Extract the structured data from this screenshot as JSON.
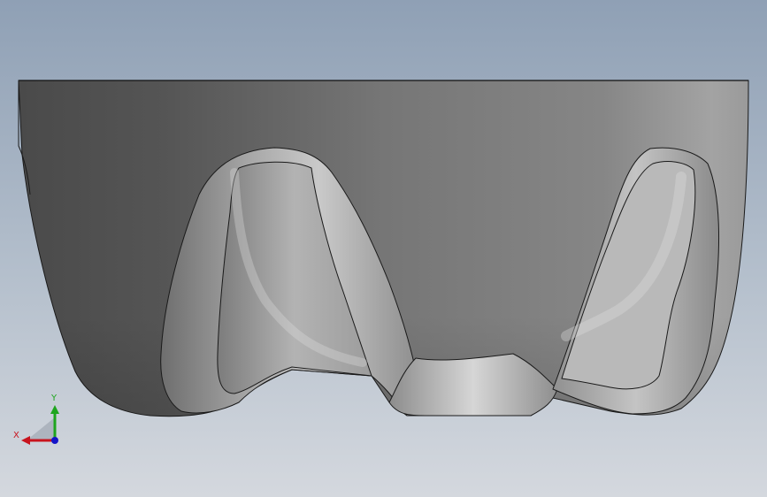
{
  "viewport": {
    "background_top": "#8fa0b5",
    "background_bottom": "#d4d8de"
  },
  "triad": {
    "x_label": "X",
    "y_label": "Y",
    "x_color": "#c8141e",
    "y_color": "#1ea51e",
    "z_color": "#1414c8"
  }
}
